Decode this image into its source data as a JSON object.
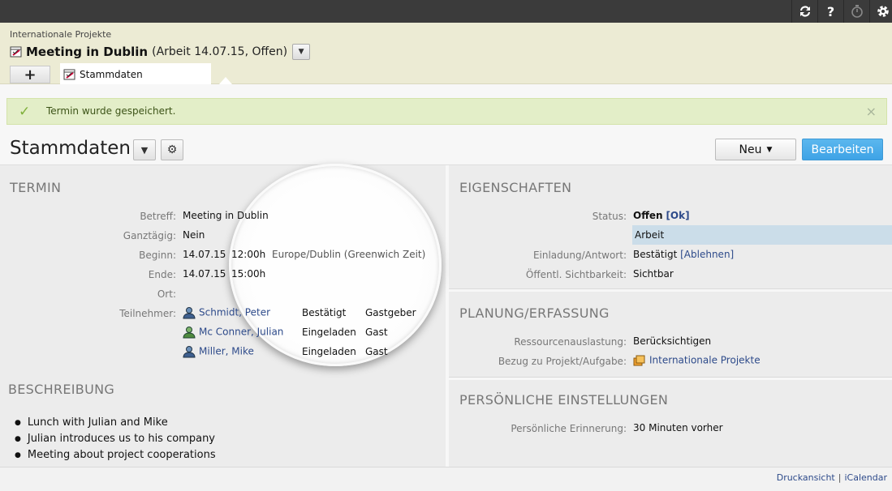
{
  "topbar": {
    "icons": [
      "sync-icon",
      "help-icon",
      "timer-icon",
      "gear-icon"
    ],
    "help_label": "?"
  },
  "header": {
    "breadcrumb": "Internationale Projekte",
    "title": "Meeting in Dublin",
    "subtitle": "(Arbeit 14.07.15, Offen)",
    "add_tab_label": "+",
    "active_tab_label": "Stammdaten"
  },
  "notice": {
    "text": "Termin wurde gespeichert.",
    "close": "×",
    "color": "#e3eec8"
  },
  "toolbar": {
    "page_title": "Stammdaten",
    "new_label": "Neu",
    "edit_label": "Bearbeiten",
    "edit_color": "#3ea3e6"
  },
  "termin": {
    "section_title": "TERMIN",
    "betreff_label": "Betreff:",
    "betreff_value": "Meeting in Dublin",
    "ganztaegig_label": "Ganztägig:",
    "ganztaegig_value": "Nein",
    "beginn_label": "Beginn:",
    "beginn_date": "14.07.15",
    "beginn_time": "12:00h",
    "timezone": "Europe/Dublin (Greenwich Zeit)",
    "ende_label": "Ende:",
    "ende_date": "14.07.15",
    "ende_time": "15:00h",
    "ort_label": "Ort:",
    "teilnehmer_label": "Teilnehmer:",
    "participants": [
      {
        "name": "Schmidt, Peter",
        "status": "Bestätigt",
        "role": "Gastgeber"
      },
      {
        "name": "Mc Conner, Julian",
        "status": "Eingeladen",
        "role": "Gast"
      },
      {
        "name": "Miller, Mike",
        "status": "Eingeladen",
        "role": "Gast"
      }
    ]
  },
  "beschreibung": {
    "section_title": "BESCHREIBUNG",
    "items": [
      "Lunch with Julian and Mike",
      "Julian introduces us to his company",
      "Meeting about project cooperations"
    ]
  },
  "eigenschaften": {
    "section_title": "EIGENSCHAFTEN",
    "status_label": "Status:",
    "status_value": "Offen",
    "status_ok": "[Ok]",
    "category": "Arbeit",
    "einladung_label": "Einladung/Antwort:",
    "einladung_value": "Bestätigt",
    "einladung_link": "[Ablehnen]",
    "sichtbarkeit_label": "Öffentl. Sichtbarkeit:",
    "sichtbarkeit_value": "Sichtbar"
  },
  "planung": {
    "section_title": "PLANUNG/ERFASSUNG",
    "ressource_label": "Ressourcenauslastung:",
    "ressource_value": "Berücksichtigen",
    "bezug_label": "Bezug zu Projekt/Aufgabe:",
    "bezug_value": "Internationale Projekte"
  },
  "persoenlich": {
    "section_title": "PERSÖNLICHE EINSTELLUNGEN",
    "erinnerung_label": "Persönliche Erinnerung:",
    "erinnerung_value": "30 Minuten vorher"
  },
  "footer": {
    "druck": "Druckansicht",
    "sep": "|",
    "ical": "iCalendar"
  }
}
